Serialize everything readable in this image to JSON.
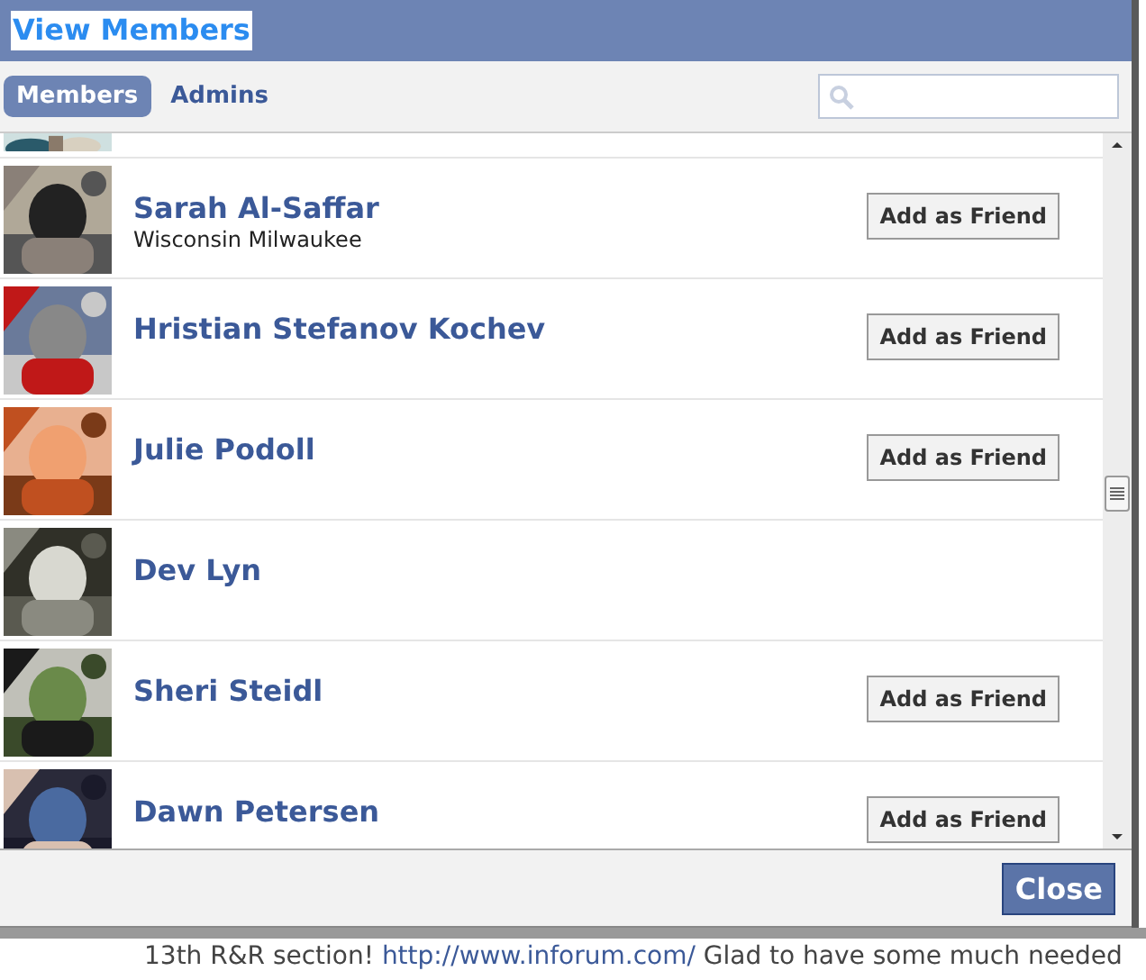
{
  "dialog": {
    "title": "View Members",
    "tabs": [
      {
        "label": "Members",
        "selected": true
      },
      {
        "label": "Admins",
        "selected": false
      }
    ],
    "members": [
      {
        "kind": "partial"
      },
      {
        "kind": "member",
        "name": "Sarah Al-Saffar",
        "network": "Wisconsin Milwaukee",
        "action": "Add as Friend"
      },
      {
        "kind": "member",
        "name": "Hristian Stefanov Kochev",
        "action": "Add as Friend"
      },
      {
        "kind": "member",
        "name": "Julie Podoll",
        "action": "Add as Friend"
      },
      {
        "kind": "member",
        "name": "Dev Lyn"
      },
      {
        "kind": "member",
        "name": "Sheri Steidl",
        "action": "Add as Friend"
      },
      {
        "kind": "member",
        "name": "Dawn Petersen",
        "action": "Add as Friend"
      }
    ],
    "close_button": "Close"
  },
  "page_text": {
    "before": "13th R&R section!",
    "link": "http://www.inforum.com/",
    "after": "Glad to have some much needed"
  }
}
